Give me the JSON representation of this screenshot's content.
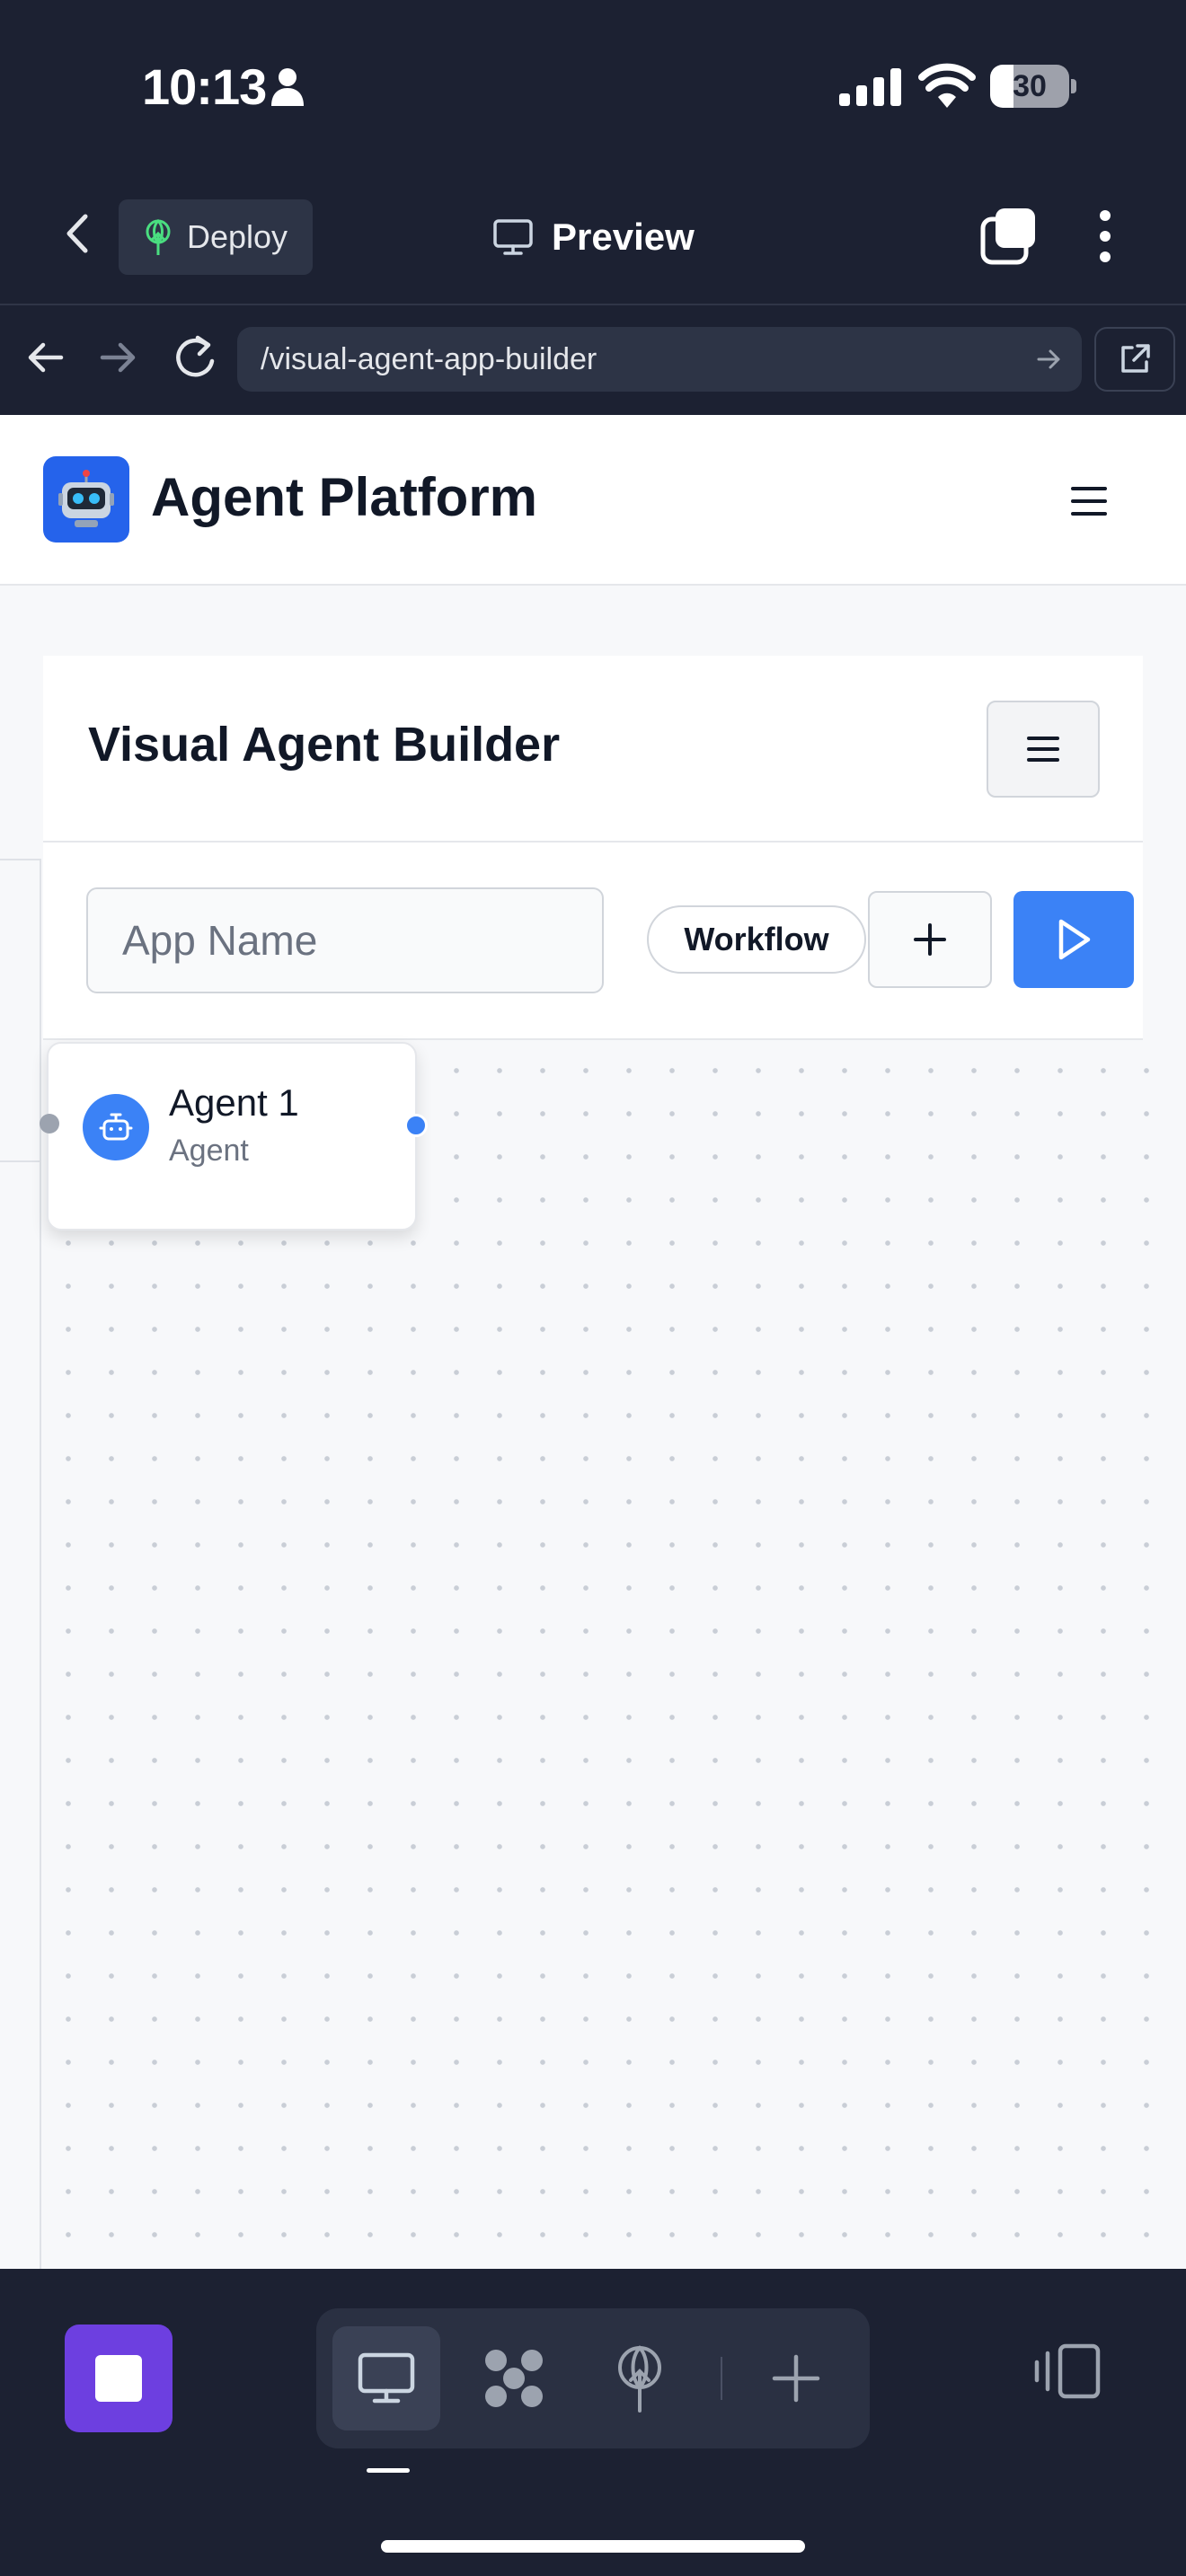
{
  "status_bar": {
    "time": "10:13",
    "battery": "30",
    "battery_level_percent": 30
  },
  "app_toolbar": {
    "deploy_label": "Deploy",
    "preview_label": "Preview"
  },
  "browser": {
    "url": "/visual-agent-app-builder"
  },
  "site": {
    "title": "Agent Platform",
    "logo_icon": "robot-emoji"
  },
  "builder": {
    "title": "Visual Agent Builder",
    "app_name_placeholder": "App Name",
    "app_name_value": "",
    "workflow_label": "Workflow"
  },
  "canvas": {
    "nodes": [
      {
        "name": "Agent 1",
        "type": "Agent",
        "icon": "bot-icon"
      }
    ]
  },
  "colors": {
    "accent": "#3b82f6",
    "logo_bg": "#2563eb",
    "stop_button": "#6d3fe0",
    "chrome_bg": "#1c2132"
  }
}
